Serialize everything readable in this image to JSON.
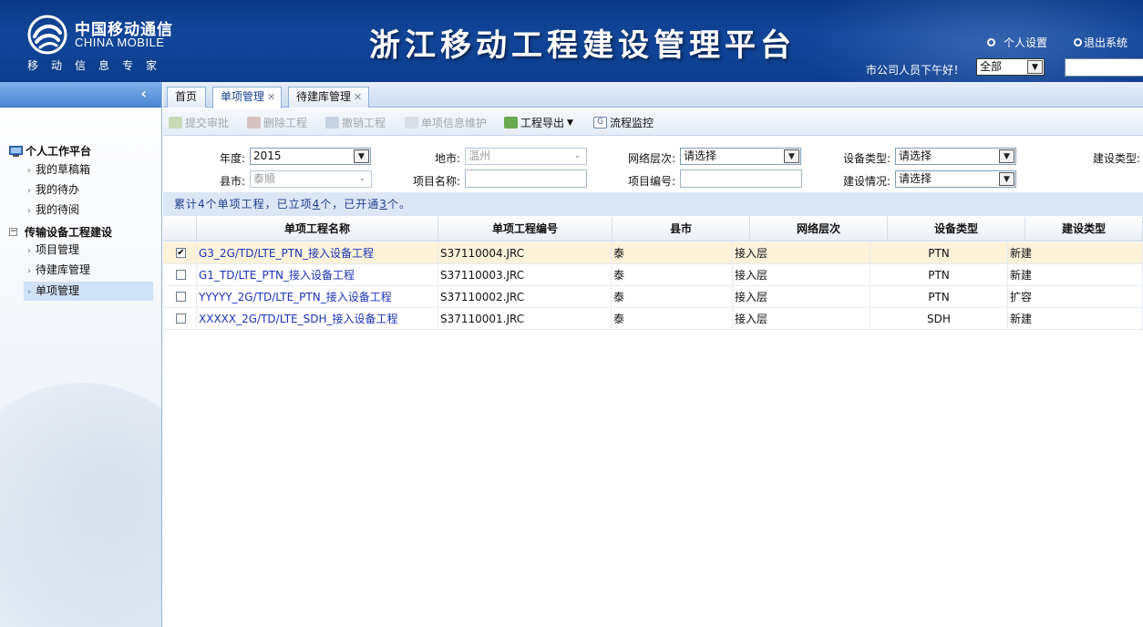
{
  "header": {
    "logo_cn": "中国移动通信",
    "logo_en": "CHINA MOBILE",
    "logo_sub": "移动信息专家",
    "title": "浙江移动工程建设管理平台",
    "personal_settings": "个人设置",
    "logout": "退出系统",
    "greeting": "市公司人员下午好！",
    "scope_select": "全部",
    "brand_color": "#0b3c8c"
  },
  "sidebar": {
    "groups": [
      {
        "label": "个人工作平台",
        "items": [
          "我的草稿箱",
          "我的待办",
          "我的待阅"
        ]
      },
      {
        "label": "传输设备工程建设",
        "items": [
          "项目管理",
          "待建库管理",
          "单项管理"
        ]
      }
    ],
    "selected": "单项管理"
  },
  "tabs": [
    {
      "label": "首页",
      "closable": false
    },
    {
      "label": "单项管理",
      "closable": true
    },
    {
      "label": "待建库管理",
      "closable": true
    }
  ],
  "toolbar": {
    "submit": "提交审批",
    "delete": "删除工程",
    "revoke": "撤销工程",
    "maintain": "单项信息维护",
    "export": "工程导出",
    "monitor": "流程监控"
  },
  "filter": {
    "year_label": "年度:",
    "year_value": "2015",
    "city_label": "地市:",
    "city_value": "温州",
    "network_label": "网络层次:",
    "network_value": "请选择",
    "device_label": "设备类型:",
    "device_value": "请选择",
    "build_type_label": "建设类型:",
    "county_label": "县市:",
    "county_value": "泰顺",
    "project_name_label": "项目名称:",
    "project_code_label": "项目编号:",
    "build_status_label": "建设情况:",
    "build_status_value": "请选择"
  },
  "summary": {
    "prefix": "累计4个单项工程，已立项",
    "approved": "4",
    "middle": "个，已开通",
    "opened": "3",
    "suffix": "个。"
  },
  "grid": {
    "columns": [
      "单项工程名称",
      "单项工程编号",
      "县市",
      "网络层次",
      "设备类型",
      "建设类型"
    ],
    "rows": [
      {
        "checked": true,
        "name": "G3_2G/TD/LTE_PTN_接入设备工程",
        "code": "S37110004.JRC",
        "county": "泰",
        "layer": "接入层",
        "device": "PTN",
        "build": "新建"
      },
      {
        "checked": false,
        "name": "G1_TD/LTE_PTN_接入设备工程",
        "code": "S37110003.JRC",
        "county": "泰",
        "layer": "接入层",
        "device": "PTN",
        "build": "新建"
      },
      {
        "checked": false,
        "name": "YYYYY_2G/TD/LTE_PTN_接入设备工程",
        "code": "S37110002.JRC",
        "county": "泰",
        "layer": "接入层",
        "device": "PTN",
        "build": "扩容"
      },
      {
        "checked": false,
        "name": "XXXXX_2G/TD/LTE_SDH_接入设备工程",
        "code": "S37110001.JRC",
        "county": "泰",
        "layer": "接入层",
        "device": "SDH",
        "build": "新建"
      }
    ]
  }
}
